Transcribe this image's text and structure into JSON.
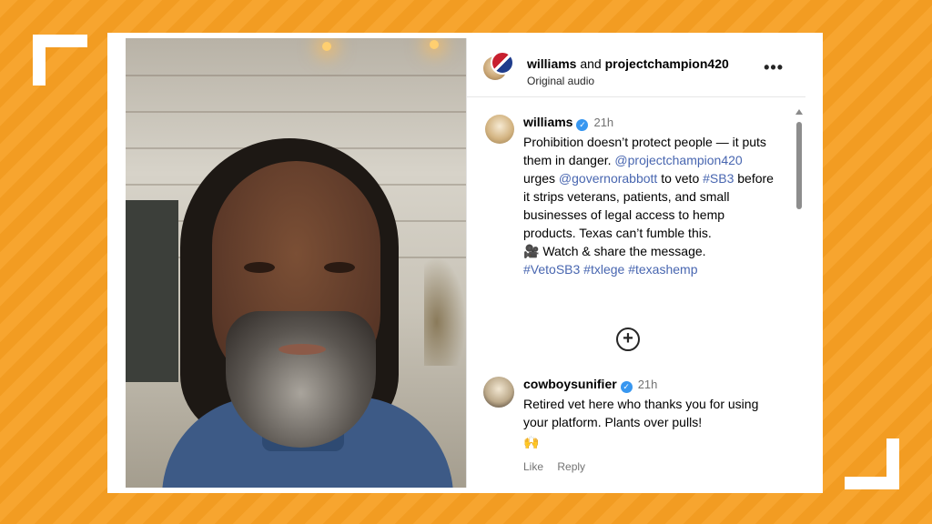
{
  "header": {
    "user1": "williams",
    "conjunction": "and",
    "user2": "projectchampion420",
    "subtitle": "Original audio",
    "more_label": "•••"
  },
  "post": {
    "username": "williams",
    "time": "21h",
    "line1": "Prohibition doesn’t protect people — it puts them in danger.",
    "mention1": "@projectchampion420",
    "word_urges": "urges",
    "mention2": "@governorabbott",
    "word_to_veto": "to veto",
    "tag_sb3": "#SB3",
    "line2": "before it strips veterans, patients, and small businesses of legal access to hemp products. Texas can’t fumble this.",
    "watch_emoji": "🎥",
    "watch_text": "Watch & share the message.",
    "tag1": "#VetoSB3",
    "tag2": "#txlege",
    "tag3": "#texashemp",
    "expand_label": "+"
  },
  "comment": {
    "username": "cowboysunifier",
    "time": "21h",
    "text": "Retired vet here who thanks you for using your platform. Plants over pulls!",
    "emoji": "🙌",
    "like_label": "Like",
    "reply_label": "Reply"
  },
  "colors": {
    "background": "#f7a52f",
    "mention": "#4866b0",
    "verified": "#3897f0"
  }
}
